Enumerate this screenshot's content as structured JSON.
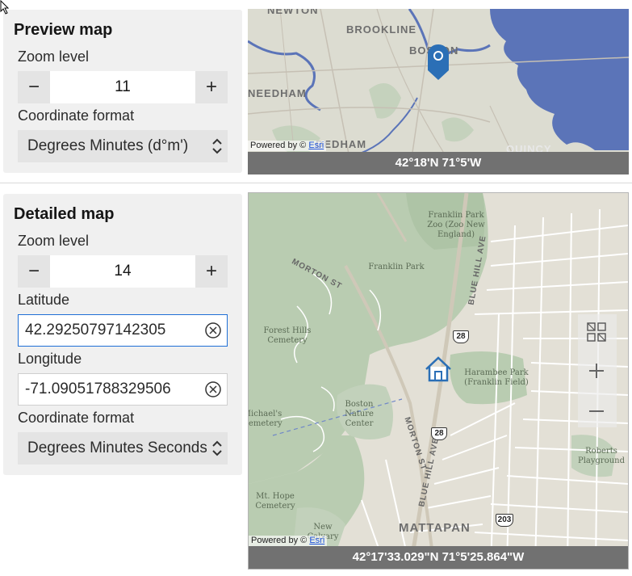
{
  "preview": {
    "title": "Preview map",
    "zoom_label": "Zoom level",
    "zoom_value": "11",
    "minus": "−",
    "plus": "+",
    "format_label": "Coordinate format",
    "format_value": "Degrees Minutes (d°m')",
    "map": {
      "labels": [
        "BROOKLINE",
        "BOSTON",
        "NEEDHAM",
        "DEDHAM",
        "QUINCY",
        "NEWTON"
      ],
      "attribution_prefix": "Powered by © ",
      "attribution_link": "Esri",
      "coordinates": "42°18'N 71°5'W"
    }
  },
  "detail": {
    "title": "Detailed map",
    "zoom_label": "Zoom level",
    "zoom_value": "14",
    "minus": "−",
    "plus": "+",
    "latitude_label": "Latitude",
    "latitude_value": "42.29250797142305",
    "longitude_label": "Longitude",
    "longitude_value": "-71.09051788329506",
    "format_label": "Coordinate format",
    "format_value": "Degrees Minutes Seconds",
    "map": {
      "labels": {
        "franklin_park_zoo": "Franklin Park Zoo (Zoo New England)",
        "franklin_park": "Franklin Park",
        "forest_hills": "Forest Hills Cemetery",
        "harambee": "Harambee Park (Franklin Field)",
        "boston_nature": "Boston Nature Center",
        "michaels": "Michael's Cemetery",
        "mt_hope": "Mt. Hope Cemetery",
        "new_calvary": "New Calvary",
        "roberts": "Roberts Playground",
        "mattapan": "MATTAPAN",
        "morton_st_1": "MORTON ST",
        "morton_st_2": "MORTON ST",
        "blue_hill_1": "BLUE HILL AVE",
        "blue_hill_2": "BLUE HILL AVE"
      },
      "shields": [
        "28",
        "28",
        "203"
      ],
      "attribution_prefix": "Powered by © ",
      "attribution_link": "Esri",
      "coordinates": "42°17'33.029\"N 71°5'25.864\"W"
    }
  },
  "colors": {
    "water": "#5b74b8",
    "park": "#b9ccb1",
    "land": "#dcdcd1",
    "focus_border": "#1f6fd6",
    "pin": "#2b6fb6"
  }
}
